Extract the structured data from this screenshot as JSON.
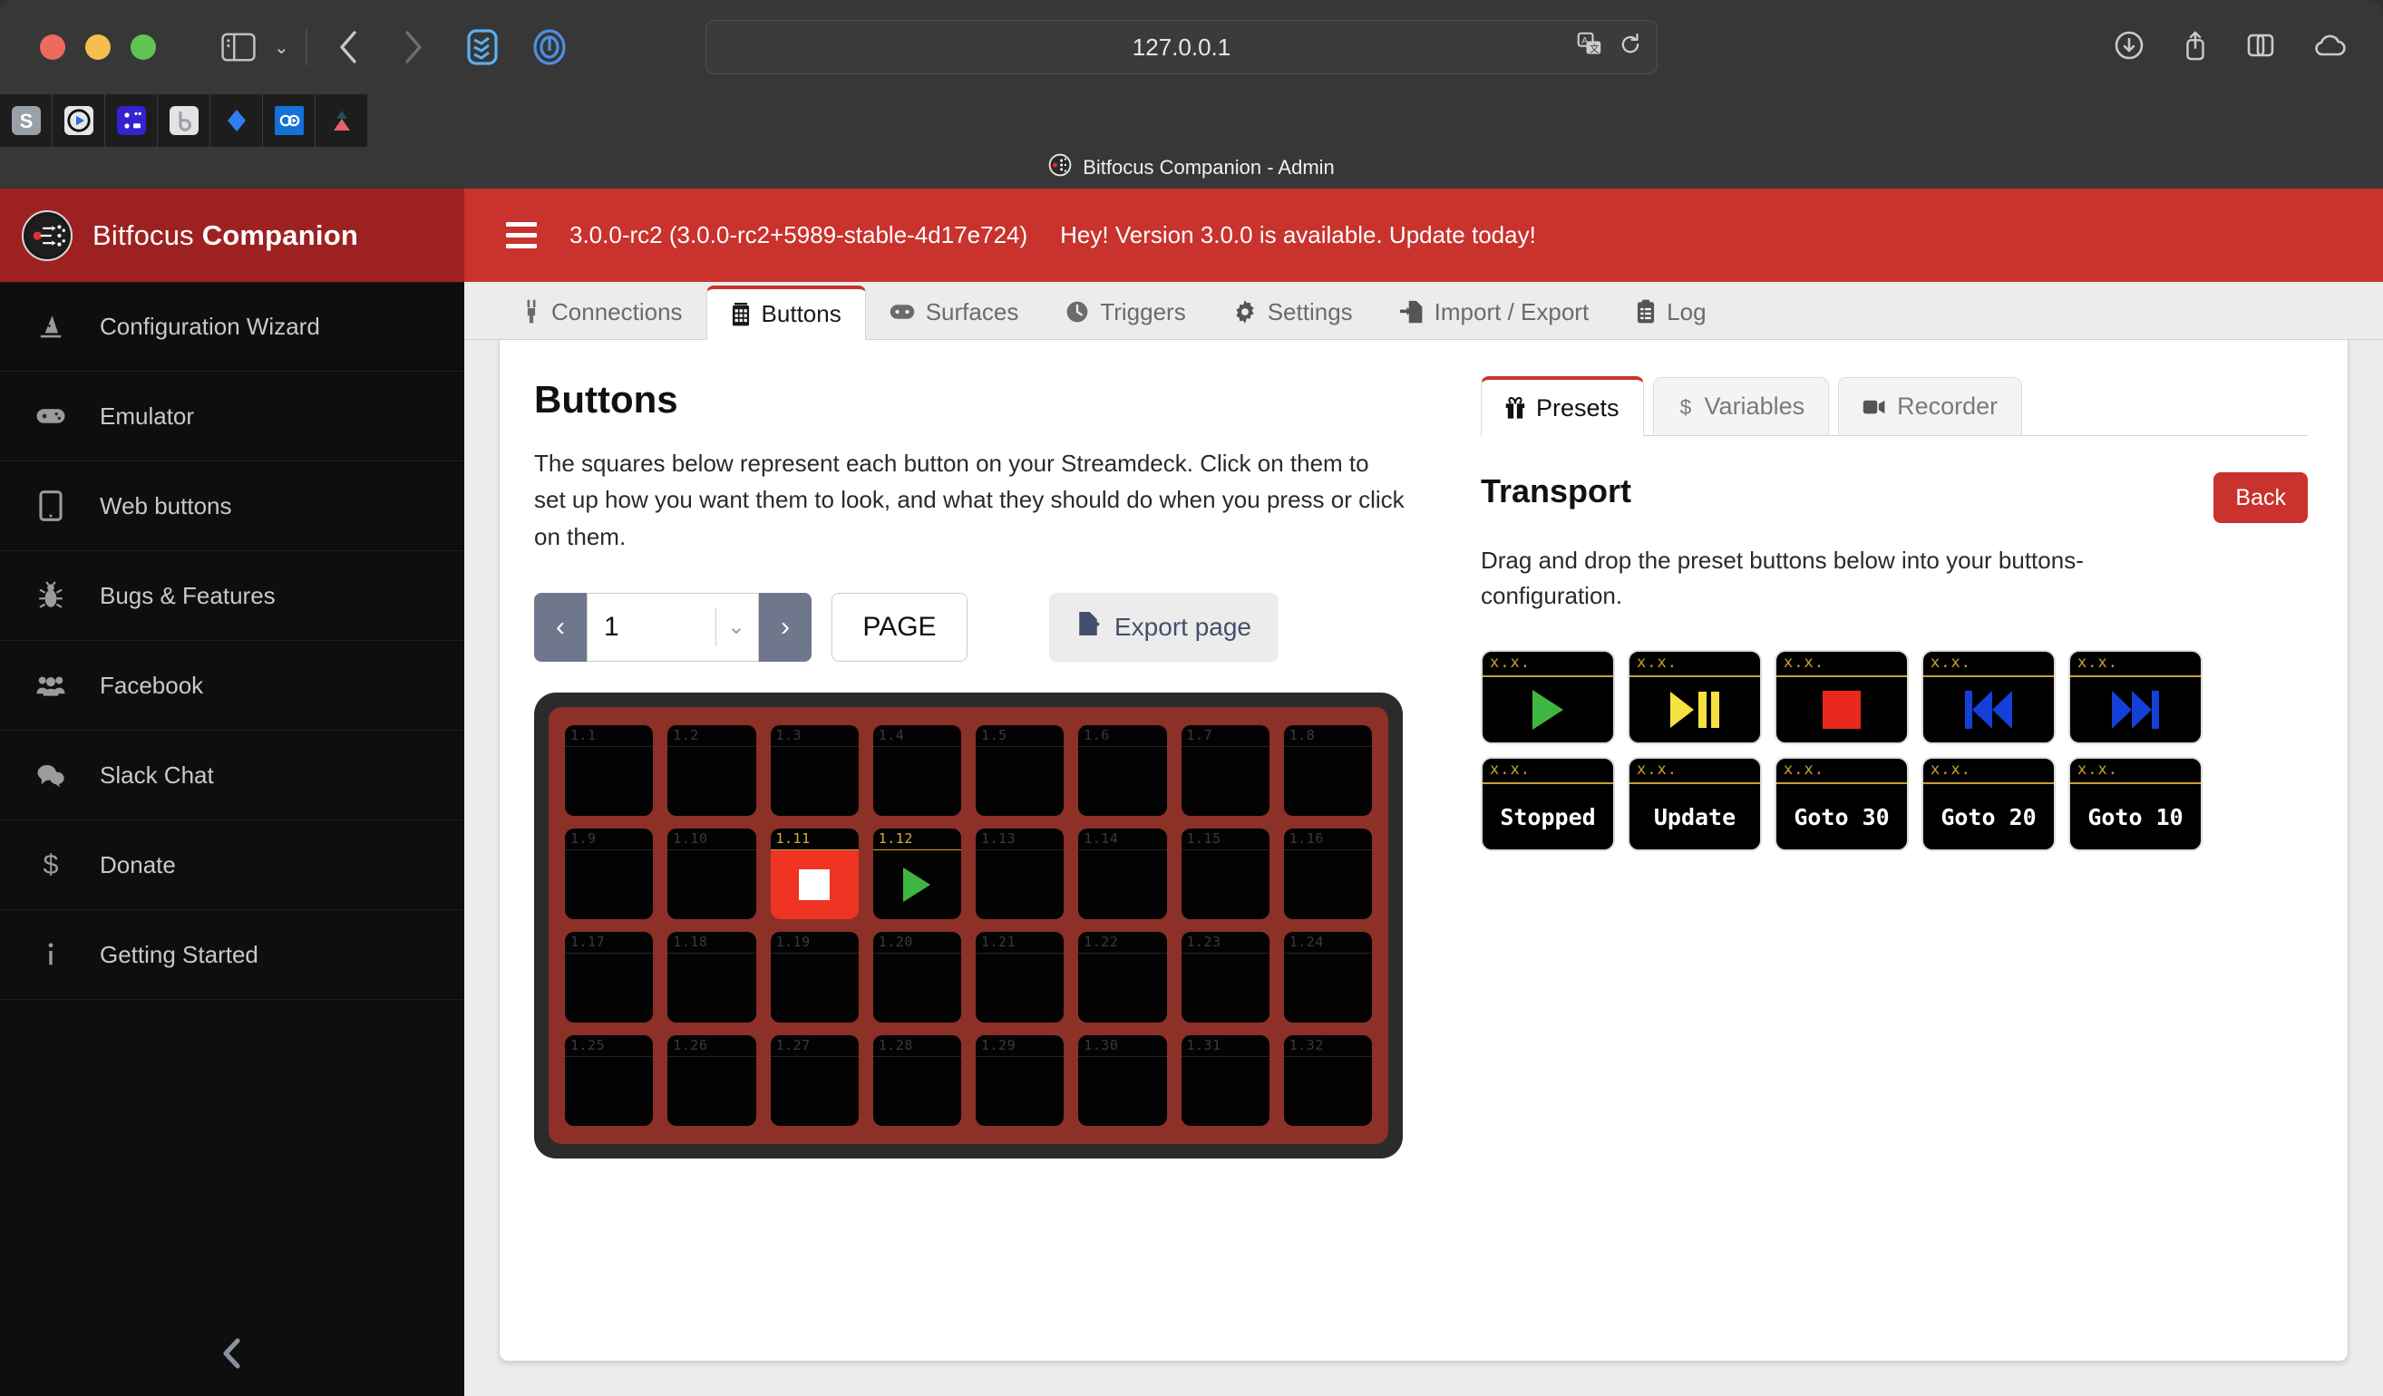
{
  "browser": {
    "url": "127.0.0.1",
    "tab_title": "Bitfocus Companion - Admin",
    "favicons": [
      "s-favicon",
      "play-favicon",
      "companion-favicon",
      "bitfocus-b-favicon",
      "jira-favicon",
      "oo-favicon",
      "triangle-favicon"
    ],
    "toolbar_icons": [
      "sidebar-icon",
      "chevron-down-icon",
      "back-icon",
      "forward-icon",
      "reader-icon",
      "onepassword-icon",
      "translate-icon",
      "reload-icon",
      "downloads-icon",
      "share-icon",
      "tabs-icon",
      "icloud-icon"
    ]
  },
  "sidebar": {
    "brand_prefix": "Bitfocus ",
    "brand_name": "Companion",
    "items": [
      {
        "label": "Configuration Wizard",
        "icon": "wizard-hat-icon"
      },
      {
        "label": "Emulator",
        "icon": "gamepad-icon"
      },
      {
        "label": "Web buttons",
        "icon": "tablet-icon"
      },
      {
        "label": "Bugs & Features",
        "icon": "bug-icon"
      },
      {
        "label": "Facebook",
        "icon": "users-icon"
      },
      {
        "label": "Slack Chat",
        "icon": "chat-bubbles-icon"
      },
      {
        "label": "Donate",
        "icon": "dollar-icon"
      },
      {
        "label": "Getting Started",
        "icon": "info-icon"
      }
    ],
    "collapse_icon": "chevron-left-icon"
  },
  "banner": {
    "version": "3.0.0-rc2 (3.0.0-rc2+5989-stable-4d17e724)",
    "message": "Hey! Version 3.0.0 is available. Update today!",
    "color": "#c9322d"
  },
  "tabs": [
    {
      "label": "Connections",
      "icon": "plug-icon",
      "active": false
    },
    {
      "label": "Buttons",
      "icon": "grid-icon",
      "active": true
    },
    {
      "label": "Surfaces",
      "icon": "surface-icon",
      "active": false
    },
    {
      "label": "Triggers",
      "icon": "clock-icon",
      "active": false
    },
    {
      "label": "Settings",
      "icon": "gear-icon",
      "active": false
    },
    {
      "label": "Import / Export",
      "icon": "import-export-icon",
      "active": false
    },
    {
      "label": "Log",
      "icon": "clipboard-icon",
      "active": false
    }
  ],
  "buttons_panel": {
    "title": "Buttons",
    "description": "The squares below represent each button on your Streamdeck. Click on them to set up how you want them to look, and what they should do when you press or click on them.",
    "page_value": "1",
    "page_label": "PAGE",
    "export_label": "Export page",
    "export_icon": "export-icon",
    "prev_icon": "chevron-left-icon",
    "next_icon": "chevron-right-icon",
    "dropdown_icon": "chevron-down-icon",
    "grid": {
      "columns": 8,
      "rows": 4,
      "cells": [
        {
          "id": "1.1"
        },
        {
          "id": "1.2"
        },
        {
          "id": "1.3"
        },
        {
          "id": "1.4"
        },
        {
          "id": "1.5"
        },
        {
          "id": "1.6"
        },
        {
          "id": "1.7"
        },
        {
          "id": "1.8"
        },
        {
          "id": "1.9"
        },
        {
          "id": "1.10"
        },
        {
          "id": "1.11",
          "highlight": true,
          "bg": "#ee3322",
          "content": "stop-square"
        },
        {
          "id": "1.12",
          "highlight": true,
          "content": "play-triangle"
        },
        {
          "id": "1.13"
        },
        {
          "id": "1.14"
        },
        {
          "id": "1.15"
        },
        {
          "id": "1.16"
        },
        {
          "id": "1.17"
        },
        {
          "id": "1.18"
        },
        {
          "id": "1.19"
        },
        {
          "id": "1.20"
        },
        {
          "id": "1.21"
        },
        {
          "id": "1.22"
        },
        {
          "id": "1.23"
        },
        {
          "id": "1.24"
        },
        {
          "id": "1.25"
        },
        {
          "id": "1.26"
        },
        {
          "id": "1.27"
        },
        {
          "id": "1.28"
        },
        {
          "id": "1.29"
        },
        {
          "id": "1.30"
        },
        {
          "id": "1.31"
        },
        {
          "id": "1.32"
        }
      ]
    }
  },
  "side_panel": {
    "tabs": [
      {
        "label": "Presets",
        "icon": "gift-icon",
        "active": true
      },
      {
        "label": "Variables",
        "icon": "dollar-icon",
        "active": false
      },
      {
        "label": "Recorder",
        "icon": "video-camera-icon",
        "active": false
      }
    ],
    "preset_group_title": "Transport",
    "back_label": "Back",
    "preset_description": "Drag and drop the preset buttons below into your buttons-configuration.",
    "presets": [
      {
        "num": "x.x.",
        "content": "play-icon",
        "text": ""
      },
      {
        "num": "x.x.",
        "content": "play-pause-icon",
        "text": ""
      },
      {
        "num": "x.x.",
        "content": "stop-icon",
        "text": ""
      },
      {
        "num": "x.x.",
        "content": "previous-icon",
        "text": ""
      },
      {
        "num": "x.x.",
        "content": "next-icon",
        "text": ""
      },
      {
        "num": "x.x.",
        "content": "text",
        "text": "Stopped"
      },
      {
        "num": "x.x.",
        "content": "text",
        "text": "Update"
      },
      {
        "num": "x.x.",
        "content": "text",
        "text": "Goto 30"
      },
      {
        "num": "x.x.",
        "content": "text",
        "text": "Goto 20"
      },
      {
        "num": "x.x.",
        "content": "text",
        "text": "Goto 10"
      }
    ]
  }
}
